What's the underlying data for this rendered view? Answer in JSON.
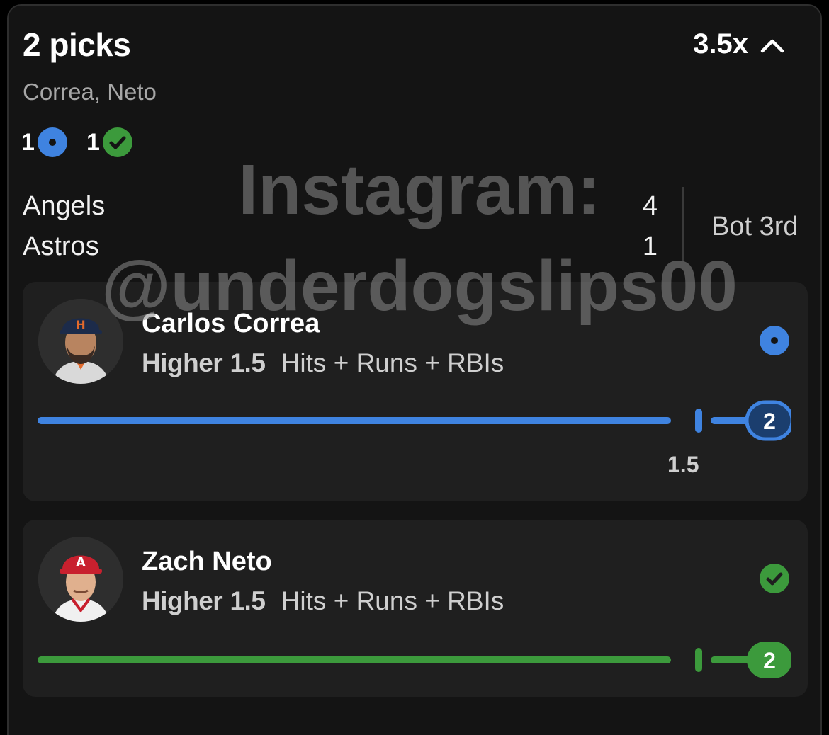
{
  "header": {
    "title": "2 picks",
    "multiplier": "3.5x",
    "subtitle": "Correa, Neto"
  },
  "tally": {
    "pending_count": "1",
    "won_count": "1"
  },
  "game": {
    "team1": {
      "name": "Angels",
      "score": "4"
    },
    "team2": {
      "name": "Astros",
      "score": "1"
    },
    "status": "Bot 3rd"
  },
  "picks": [
    {
      "player": "Carlos Correa",
      "direction": "Higher",
      "line": "1.5",
      "stat": "Hits + Runs + RBIs",
      "current": "2",
      "line_label": "1.5",
      "status": "pending",
      "color": "#3f83e0"
    },
    {
      "player": "Zach Neto",
      "direction": "Higher",
      "line": "1.5",
      "stat": "Hits + Runs + RBIs",
      "current": "2",
      "status": "won",
      "color": "#3c9a3c"
    }
  ],
  "watermark": {
    "line1": "Instagram:",
    "line2": "@underdogslips00"
  },
  "icons": {
    "collapse": "chevron-up-icon",
    "pending": "pending-dot-icon",
    "won": "checkmark-icon"
  }
}
